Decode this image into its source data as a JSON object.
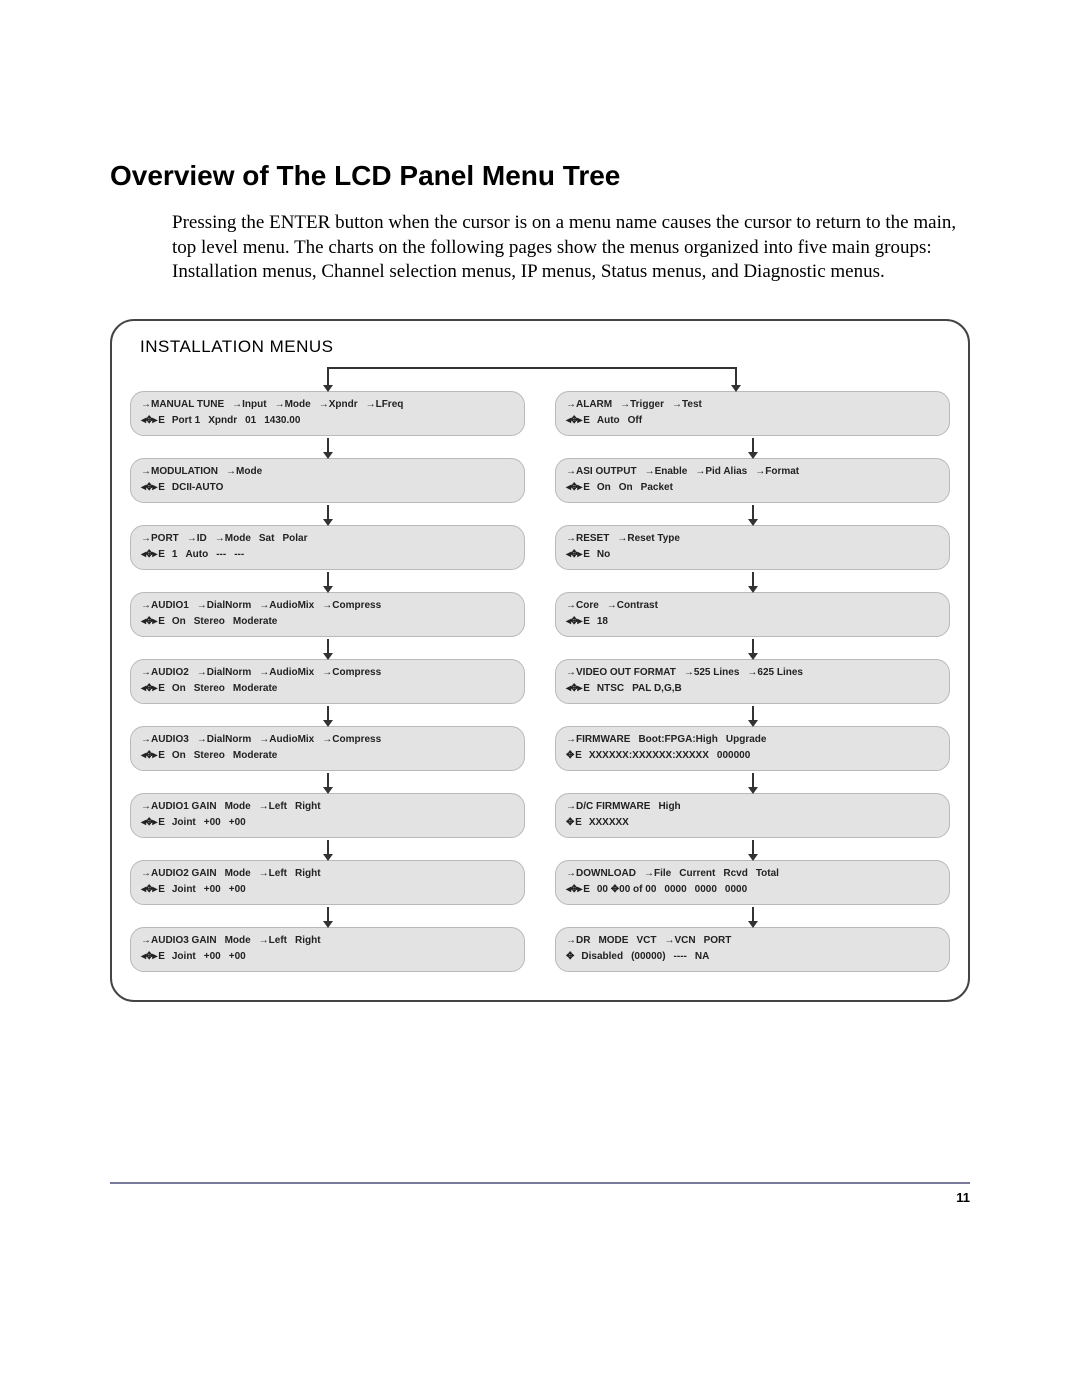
{
  "heading": "Overview of The LCD Panel Menu Tree",
  "intro": "Pressing the ENTER button when the cursor is on a menu name causes the cursor to return to the main, top level menu. The charts on the following pages show the menus organized into five main groups: Installation menus, Channel selection menus, IP menus, Status menus, and Diagnostic menus.",
  "diagram_title": "INSTALLATION MENUS",
  "page_number": "11",
  "nav_symbol_full": "◂✥▸ E",
  "nav_symbol_vert": "✥ E",
  "nav_symbol_vert_only": "✥",
  "left": [
    {
      "row1": [
        "→MANUAL TUNE",
        "→Input",
        "→Mode",
        "→Xpndr",
        "→LFreq"
      ],
      "row2": [
        "◂✥▸ E",
        "Port 1",
        "Xpndr",
        "01",
        "1430.00"
      ]
    },
    {
      "row1": [
        "→MODULATION",
        "→Mode"
      ],
      "row2": [
        "◂✥▸ E",
        "DCII-AUTO"
      ]
    },
    {
      "row1": [
        "→PORT",
        "→ID",
        "→Mode",
        "Sat",
        "Polar"
      ],
      "row2": [
        "◂✥▸ E",
        "1",
        "Auto",
        "---",
        "---"
      ]
    },
    {
      "row1": [
        "→AUDIO1",
        "→DialNorm",
        "→AudioMix",
        "→Compress"
      ],
      "row2": [
        "◂✥▸ E",
        "On",
        "Stereo",
        "Moderate"
      ]
    },
    {
      "row1": [
        "→AUDIO2",
        "→DialNorm",
        "→AudioMix",
        "→Compress"
      ],
      "row2": [
        "◂✥▸ E",
        "On",
        "Stereo",
        "Moderate"
      ]
    },
    {
      "row1": [
        "→AUDIO3",
        "→DialNorm",
        "→AudioMix",
        "→Compress"
      ],
      "row2": [
        "◂✥▸ E",
        "On",
        "Stereo",
        "Moderate"
      ]
    },
    {
      "row1": [
        "→AUDIO1 GAIN",
        "Mode",
        "→Left",
        "Right"
      ],
      "row2": [
        "◂✥▸ E",
        "Joint",
        "+00",
        "+00"
      ]
    },
    {
      "row1": [
        "→AUDIO2 GAIN",
        "Mode",
        "→Left",
        "Right"
      ],
      "row2": [
        "◂✥▸ E",
        "Joint",
        "+00",
        "+00"
      ]
    },
    {
      "row1": [
        "→AUDIO3 GAIN",
        "Mode",
        "→Left",
        "Right"
      ],
      "row2": [
        "◂✥▸ E",
        "Joint",
        "+00",
        "+00"
      ]
    }
  ],
  "right": [
    {
      "row1": [
        "→ALARM",
        "→Trigger",
        "→Test"
      ],
      "row2": [
        "◂✥▸ E",
        "Auto",
        "Off"
      ]
    },
    {
      "row1": [
        "→ASI OUTPUT",
        "→Enable",
        "→Pid Alias",
        "→Format"
      ],
      "row2": [
        "◂✥▸ E",
        "On",
        "On",
        "Packet"
      ]
    },
    {
      "row1": [
        "→RESET",
        "→Reset Type"
      ],
      "row2": [
        "◂✥▸ E",
        "No"
      ]
    },
    {
      "row1": [
        "→Core",
        "→Contrast"
      ],
      "row2": [
        "◂✥▸ E",
        "18"
      ]
    },
    {
      "row1": [
        "→VIDEO OUT FORMAT",
        "→525 Lines",
        "→625 Lines"
      ],
      "row2": [
        "◂✥▸ E",
        "NTSC",
        "PAL D,G,B"
      ]
    },
    {
      "row1": [
        "→FIRMWARE",
        "Boot:FPGA:High",
        "Upgrade"
      ],
      "row2": [
        "✥ E",
        "XXXXXX:XXXXXX:XXXXX",
        "000000"
      ]
    },
    {
      "row1": [
        "→D/C FIRMWARE",
        "High"
      ],
      "row2": [
        "✥ E",
        "XXXXXX"
      ]
    },
    {
      "row1": [
        "→DOWNLOAD",
        "→File",
        "Current",
        "Rcvd",
        "Total"
      ],
      "row2": [
        "◂✥▸ E",
        "00 ✥00 of 00",
        "0000",
        "0000",
        "0000"
      ]
    },
    {
      "row1": [
        "→DR",
        "MODE",
        "VCT",
        "→VCN",
        "PORT"
      ],
      "row2": [
        "✥",
        "Disabled",
        "(00000)",
        "----",
        "NA"
      ]
    }
  ]
}
